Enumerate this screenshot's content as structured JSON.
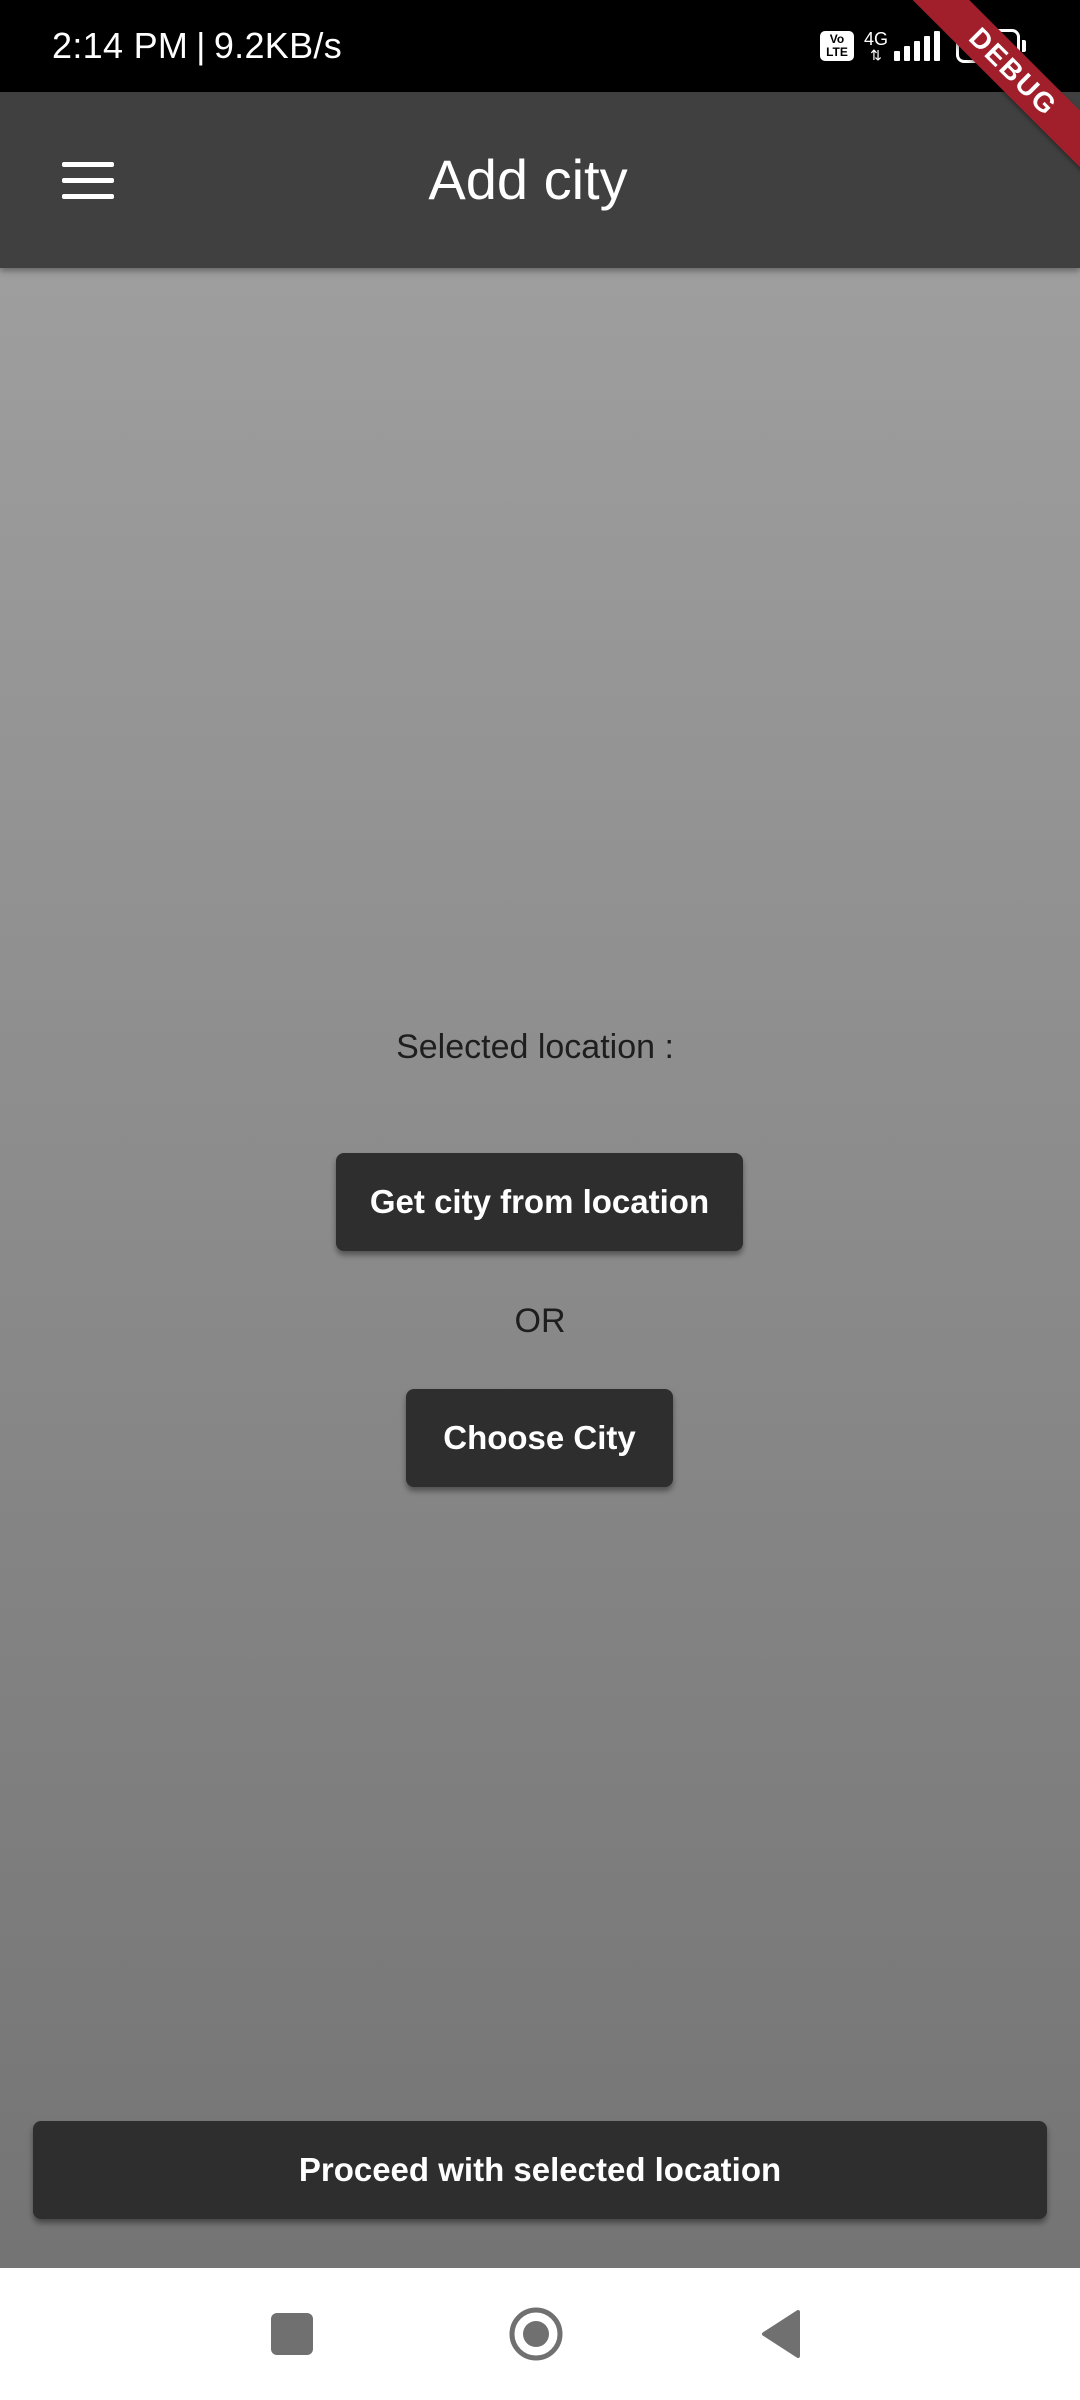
{
  "status_bar": {
    "time": "2:14 PM",
    "separator": "|",
    "speed": "9.2KB/s",
    "volte_line1": "Vo",
    "volte_line2": "LTE",
    "network": "4G",
    "battery": "68",
    "icons": [
      "volte-icon",
      "network-4g-icon",
      "signal-icon",
      "battery-icon"
    ]
  },
  "debug_banner": "DEBUG",
  "app_bar": {
    "title": "Add city",
    "menu_icon": "hamburger-menu-icon"
  },
  "main": {
    "selected_location_label": "Selected location :",
    "get_city_button": "Get city from location",
    "or_label": "OR",
    "choose_city_button": "Choose City",
    "proceed_button": "Proceed with selected location"
  },
  "nav_bar": {
    "icons": [
      "recent-apps-icon",
      "home-icon",
      "back-icon"
    ]
  },
  "colors": {
    "status_bar": "#000000",
    "app_bar": "#404040",
    "button": "#2e2e2e",
    "debug_banner": "#a01f2b",
    "nav_bar": "#ffffff",
    "nav_icon": "#707070"
  }
}
